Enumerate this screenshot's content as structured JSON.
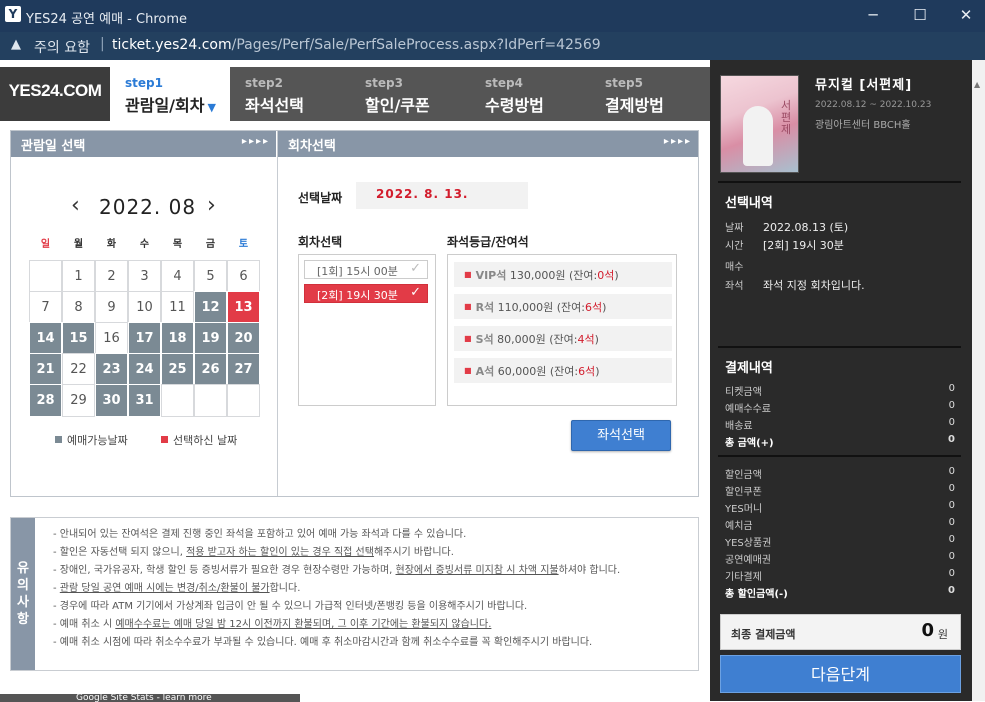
{
  "window": {
    "app_icon": "Y",
    "title": "YES24 공연 예매 - Chrome",
    "controls": {
      "minimize": "─",
      "maximize": "☐",
      "close": "✕"
    }
  },
  "address": {
    "warning_label": "주의 요함",
    "separator": "|",
    "host": "ticket.yes24.com",
    "path": "/Pages/Perf/Sale/PerfSaleProcess.aspx?IdPerf=42569"
  },
  "logo": "YES24.COM",
  "steps": [
    {
      "num": "step1",
      "name": "관람일/회차",
      "active": true
    },
    {
      "num": "step2",
      "name": "좌석선택"
    },
    {
      "num": "step3",
      "name": "할인/쿠폰"
    },
    {
      "num": "step4",
      "name": "수령방법"
    },
    {
      "num": "step5",
      "name": "결제방법"
    }
  ],
  "date_panel": {
    "title": "관람일 선택",
    "arrows": "▸▸▸▸",
    "month": "2022. 08",
    "prev": "‹",
    "next": "›",
    "weekdays": [
      "일",
      "월",
      "화",
      "수",
      "목",
      "금",
      "토"
    ],
    "weekday_colors": [
      "#e23b47",
      "#333333",
      "#333333",
      "#333333",
      "#333333",
      "#333333",
      "#2b7bd6"
    ],
    "days": [
      {
        "d": ""
      },
      {
        "d": "1"
      },
      {
        "d": "2"
      },
      {
        "d": "3"
      },
      {
        "d": "4"
      },
      {
        "d": "5"
      },
      {
        "d": "6"
      },
      {
        "d": "7"
      },
      {
        "d": "8"
      },
      {
        "d": "9"
      },
      {
        "d": "10"
      },
      {
        "d": "11"
      },
      {
        "d": "12",
        "s": "av"
      },
      {
        "d": "13",
        "s": "sel"
      },
      {
        "d": "14",
        "s": "av"
      },
      {
        "d": "15",
        "s": "av"
      },
      {
        "d": "16"
      },
      {
        "d": "17",
        "s": "av"
      },
      {
        "d": "18",
        "s": "av"
      },
      {
        "d": "19",
        "s": "av"
      },
      {
        "d": "20",
        "s": "av"
      },
      {
        "d": "21",
        "s": "av"
      },
      {
        "d": "22"
      },
      {
        "d": "23",
        "s": "av"
      },
      {
        "d": "24",
        "s": "av"
      },
      {
        "d": "25",
        "s": "av"
      },
      {
        "d": "26",
        "s": "av"
      },
      {
        "d": "27",
        "s": "av"
      },
      {
        "d": "28",
        "s": "av"
      },
      {
        "d": "29"
      },
      {
        "d": "30",
        "s": "av"
      },
      {
        "d": "31",
        "s": "av"
      },
      {
        "d": ""
      },
      {
        "d": ""
      },
      {
        "d": ""
      }
    ],
    "legend_available": "예매가능날짜",
    "legend_selected": "선택하신 날짜",
    "color_available": "#7b8a94",
    "color_selected": "#e23b47"
  },
  "session_panel": {
    "title": "회차선택",
    "arrows": "▸▸▸▸",
    "date_label": "선택날짜",
    "date_value": "2022. 8. 13.",
    "session_label": "회차선택",
    "sessions": [
      {
        "label": "[1회] 15시 00분",
        "selected": false
      },
      {
        "label": "[2회] 19시 30분",
        "selected": true
      }
    ],
    "grade_label": "좌석등급/잔여석",
    "grades": [
      {
        "grade": "VIP석",
        "price": "130,000원",
        "rem_open": "(잔여:",
        "count": "0석",
        "rem_close": ")"
      },
      {
        "grade": "R석",
        "price": "110,000원",
        "rem_open": "(잔여:",
        "count": "6석",
        "rem_close": ")"
      },
      {
        "grade": "S석",
        "price": "80,000원",
        "rem_open": "(잔여:",
        "count": "4석",
        "rem_close": ")"
      },
      {
        "grade": "A석",
        "price": "60,000원",
        "rem_open": "(잔여:",
        "count": "6석",
        "rem_close": ")"
      }
    ],
    "seat_button": "좌석선택"
  },
  "notice": {
    "side_title": [
      "유",
      "의",
      "사",
      "항"
    ],
    "items": [
      {
        "t": "- 안내되어 있는 잔여석은 결제 진행 중인 좌석을 포함하고 있어 예매 가능 좌석과 다를 수 있습니다."
      },
      {
        "t": "- 할인은 자동선택 되지 않으니, ",
        "u": "적용 받고자 하는 할인이 있는 경우 직접 선택",
        "t2": "해주시기 바랍니다."
      },
      {
        "t": "- 장애인, 국가유공자, 학생 할인 등 증빙서류가 필요한 경우 현장수령만 가능하며, ",
        "u": "현장에서 증빙서류 미지참 시 차액 지불",
        "t2": "하셔야 합니다."
      },
      {
        "t": "- ",
        "u": "관람 당일 공연 예매 시에는 변경/취소/환불이 불가",
        "t2": "합니다."
      },
      {
        "t": "- 경우에 따라 ATM 기기에서 가상계좌 입금이 안 될 수 있으니 가급적 인터넷/폰뱅킹 등을 이용해주시기 바랍니다."
      },
      {
        "t": "- 예매 취소 시 ",
        "u": "예매수수료는 예매 당일 밤 12시 이전까지 환불되며, 그 이후 기간에는 환불되지 않습니다.",
        "t2": ""
      },
      {
        "t": "- 예매 취소 시점에 따라 취소수수료가 부과될 수 있습니다. 예매 후 취소마감시간과 함께 취소수수료를 꼭 확인해주시기 바랍니다."
      }
    ]
  },
  "google_site_stats": "Google Site Stats - learn more",
  "sidebar": {
    "poster_text": "서편제",
    "show_title": "뮤지컬 [서편제]",
    "show_dates": "2022.08.12 ~ 2022.10.23",
    "show_venue": "광림아트센터 BBCH홀",
    "selection_title": "선택내역",
    "selection": [
      {
        "k": "날짜",
        "v": "2022.08.13 (토)"
      },
      {
        "k": "시간",
        "v": "[2회] 19시 30분"
      },
      {
        "k": "매수",
        "v": ""
      },
      {
        "k": "좌석",
        "v": "좌석 지정 회차입니다."
      }
    ],
    "payment_title": "결제내역",
    "payment": [
      {
        "k": "티켓금액",
        "v": "0"
      },
      {
        "k": "예매수수료",
        "v": "0"
      },
      {
        "k": "배송료",
        "v": "0"
      },
      {
        "k": "총 금액(+)",
        "v": "0",
        "bold": true
      }
    ],
    "discounts": [
      {
        "k": "할인금액",
        "v": "0"
      },
      {
        "k": "할인쿠폰",
        "v": "0"
      },
      {
        "k": "YES머니",
        "v": "0"
      },
      {
        "k": "예치금",
        "v": "0"
      },
      {
        "k": "YES상품권",
        "v": "0"
      },
      {
        "k": "공연예매권",
        "v": "0"
      },
      {
        "k": "기타결제",
        "v": "0"
      },
      {
        "k": "총 할인금액(-)",
        "v": "0",
        "bold": true
      }
    ],
    "final_label": "최종 결제금액",
    "final_amount": "0",
    "final_unit": "원",
    "next_button": "다음단계"
  }
}
